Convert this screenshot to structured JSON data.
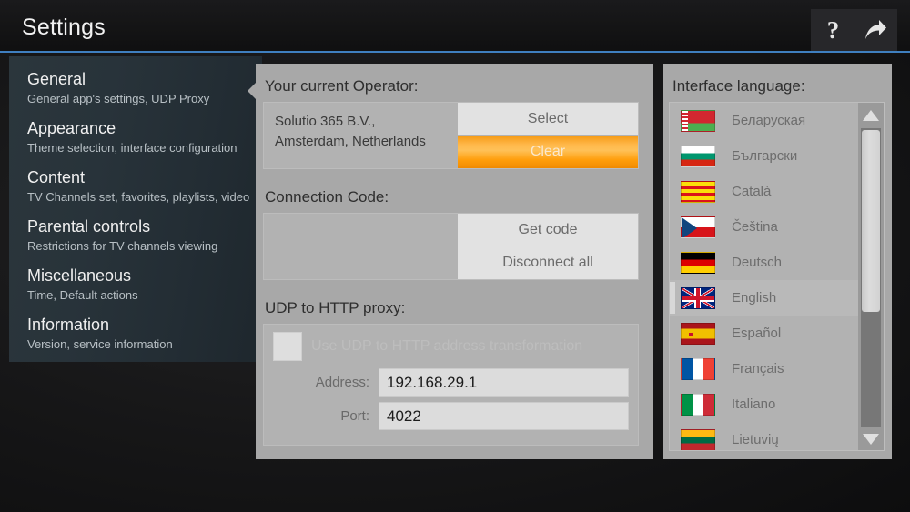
{
  "header": {
    "title": "Settings",
    "help_icon": "question-mark-icon",
    "forward_icon": "forward-arrow-icon"
  },
  "sidebar": {
    "items": [
      {
        "title": "General",
        "subtitle": "General app's settings, UDP Proxy",
        "selected": true
      },
      {
        "title": "Appearance",
        "subtitle": "Theme selection, interface configuration",
        "selected": false
      },
      {
        "title": "Content",
        "subtitle": "TV Channels set, favorites, playlists, video",
        "selected": false
      },
      {
        "title": "Parental controls",
        "subtitle": "Restrictions for TV channels viewing",
        "selected": false
      },
      {
        "title": "Miscellaneous",
        "subtitle": "Time, Default actions",
        "selected": false
      },
      {
        "title": "Information",
        "subtitle": "Version, service information",
        "selected": false
      }
    ]
  },
  "content": {
    "operator": {
      "label": "Your current Operator:",
      "name_line1": "Solutio 365 B.V.,",
      "name_line2": "Amsterdam, Netherlands",
      "select_button": "Select",
      "clear_button": "Clear",
      "clear_button_color": "#ffb33a"
    },
    "connection_code": {
      "label": "Connection Code:",
      "get_code_button": "Get code",
      "disconnect_button": "Disconnect all"
    },
    "udp_proxy": {
      "label": "UDP to HTTP proxy:",
      "checkbox_label": "Use UDP to HTTP address transformation",
      "checkbox_checked": false,
      "address_label": "Address:",
      "address_value": "192.168.29.1",
      "port_label": "Port:",
      "port_value": "4022"
    }
  },
  "language_panel": {
    "label": "Interface language:",
    "languages": [
      {
        "name": "Беларуская",
        "flag": "flag-belarus",
        "selected": false
      },
      {
        "name": "Български",
        "flag": "flag-bulgaria",
        "selected": false
      },
      {
        "name": "Català",
        "flag": "flag-catalonia",
        "selected": false
      },
      {
        "name": "Čeština",
        "flag": "flag-czechia",
        "selected": false
      },
      {
        "name": "Deutsch",
        "flag": "flag-germany",
        "selected": false
      },
      {
        "name": "English",
        "flag": "flag-uk",
        "selected": true
      },
      {
        "name": "Español",
        "flag": "flag-spain",
        "selected": false
      },
      {
        "name": "Français",
        "flag": "flag-france",
        "selected": false
      },
      {
        "name": "Italiano",
        "flag": "flag-italy",
        "selected": false
      },
      {
        "name": "Lietuvių",
        "flag": "flag-lithuania",
        "selected": false
      }
    ]
  }
}
